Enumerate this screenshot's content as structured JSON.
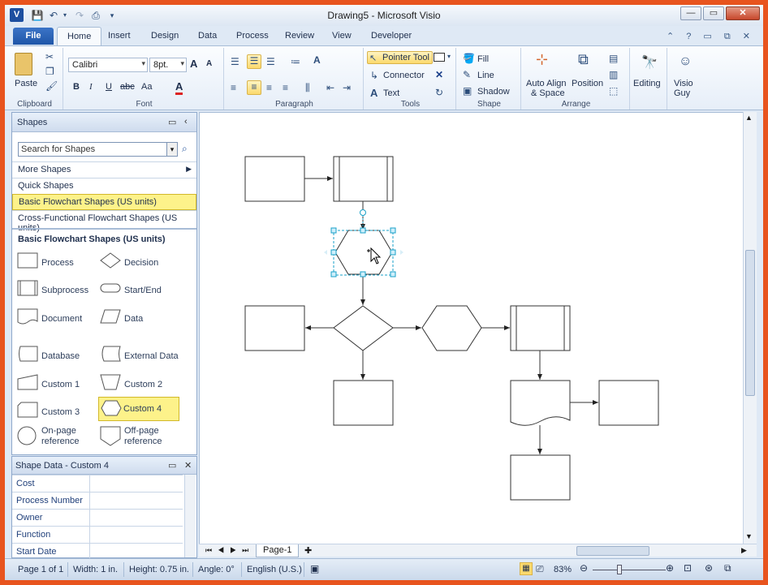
{
  "window": {
    "title": "Drawing5  -  Microsoft Visio",
    "app_logo": "V",
    "min_label": "—",
    "max_label": "▭",
    "close_label": "✕"
  },
  "tabs": {
    "file": "File",
    "items": [
      "Home",
      "Insert",
      "Design",
      "Data",
      "Process",
      "Review",
      "View",
      "Developer"
    ]
  },
  "ribbon": {
    "clipboard": {
      "label": "Clipboard",
      "paste": "Paste"
    },
    "font": {
      "label": "Font",
      "name": "Calibri",
      "size": "8pt.",
      "bold": "B",
      "italic": "I",
      "underline": "U",
      "strike": "abc",
      "case": "Aa",
      "color": "A",
      "grow": "A",
      "shrink": "A"
    },
    "paragraph": {
      "label": "Paragraph"
    },
    "tools": {
      "label": "Tools",
      "pointer": "Pointer Tool",
      "connector": "Connector",
      "text": "Text"
    },
    "shape": {
      "label": "Shape",
      "fill": "Fill",
      "line": "Line",
      "shadow": "Shadow"
    },
    "arrange": {
      "label": "Arrange",
      "auto_align_1": "Auto Align",
      "auto_align_2": "& Space",
      "position": "Position"
    },
    "editing": {
      "label": "Editing"
    },
    "visio_guy": {
      "label_1": "Visio",
      "label_2": "Guy"
    }
  },
  "shapes_pane": {
    "title": "Shapes",
    "search_placeholder": "Search for Shapes",
    "more_shapes": "More Shapes",
    "quick_shapes": "Quick Shapes",
    "stencil_selected": "Basic Flowchart Shapes (US units)",
    "stencil_other": "Cross-Functional Flowchart Shapes (US units)",
    "stencil_title": "Basic Flowchart Shapes (US units)",
    "masters": [
      "Process",
      "Decision",
      "Subprocess",
      "Start/End",
      "Document",
      "Data",
      "Database",
      "External Data",
      "Custom 1",
      "Custom 2",
      "Custom 3",
      "Custom 4",
      "On-page reference",
      "Off-page reference"
    ]
  },
  "shape_data": {
    "title": "Shape Data - Custom 4",
    "rows": [
      "Cost",
      "Process Number",
      "Owner",
      "Function",
      "Start Date"
    ]
  },
  "page": {
    "tab": "Page-1"
  },
  "status": {
    "page": "Page 1 of 1",
    "width": "Width: 1 in.",
    "height": "Height: 0.75 in.",
    "angle": "Angle: 0°",
    "language": "English (U.S.)",
    "zoom": "83%"
  },
  "colors": {
    "frame": "#e8541e",
    "highlight": "#fdf28a",
    "selection": "#18a0c8"
  }
}
